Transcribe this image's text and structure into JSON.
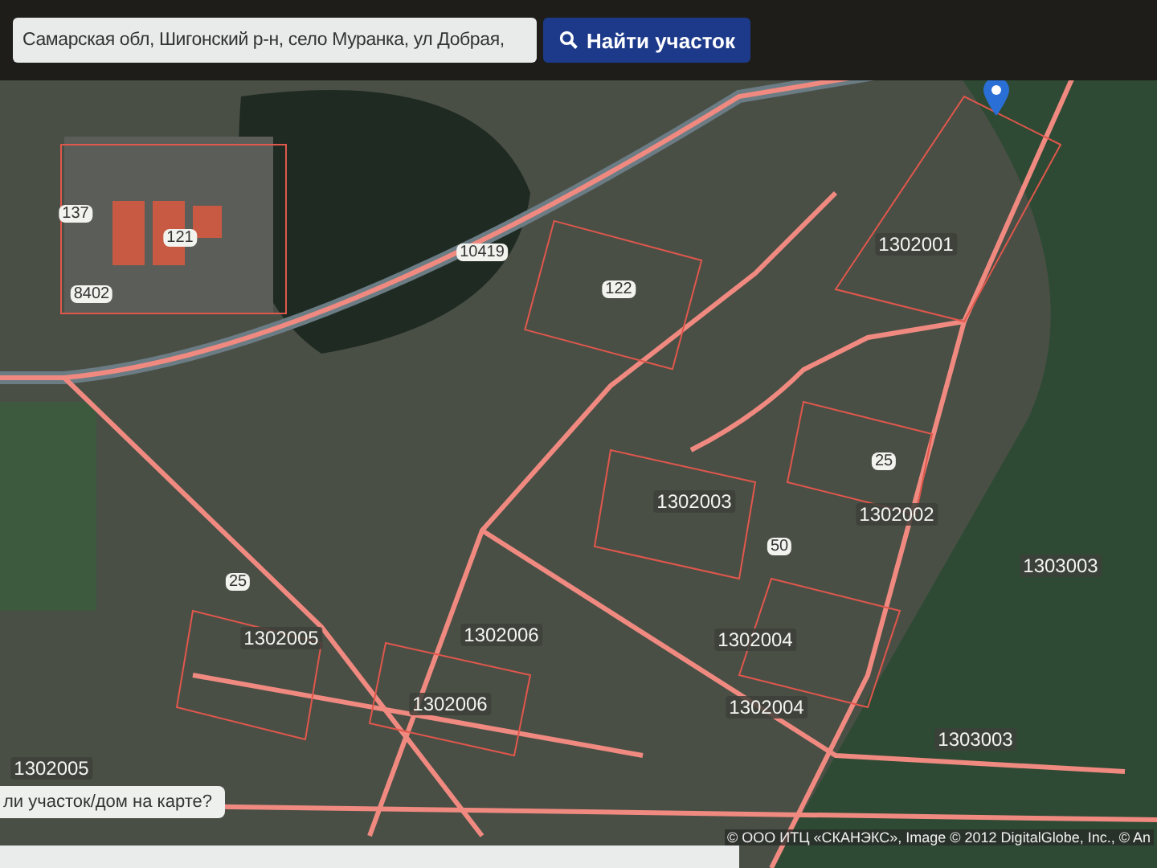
{
  "search": {
    "value": "Самарская обл, Шигонский р-н, село Муранка, ул Добрая,",
    "button": "Найти участок"
  },
  "map_labels": [
    {
      "text": "137",
      "kind": "parcel"
    },
    {
      "text": "121",
      "kind": "parcel"
    },
    {
      "text": "10419",
      "kind": "parcel"
    },
    {
      "text": "1302001",
      "kind": "quarter"
    },
    {
      "text": "8402",
      "kind": "parcel"
    },
    {
      "text": "122",
      "kind": "parcel"
    },
    {
      "text": "25",
      "kind": "parcel"
    },
    {
      "text": "1302003",
      "kind": "quarter"
    },
    {
      "text": "1302002",
      "kind": "quarter"
    },
    {
      "text": "50",
      "kind": "parcel"
    },
    {
      "text": "1303003",
      "kind": "quarter"
    },
    {
      "text": "25",
      "kind": "parcel"
    },
    {
      "text": "1302005",
      "kind": "quarter"
    },
    {
      "text": "1302006",
      "kind": "quarter"
    },
    {
      "text": "1302004",
      "kind": "quarter"
    },
    {
      "text": "1302006",
      "kind": "quarter"
    },
    {
      "text": "1302004",
      "kind": "quarter"
    },
    {
      "text": "1303003",
      "kind": "quarter"
    },
    {
      "text": "1302005",
      "kind": "quarter"
    }
  ],
  "hint": "ли участок/дом на карте?",
  "attribution": "© ООО ИТЦ «СКАНЭКС», Image © 2012 DigitalGlobe, Inc., © An"
}
